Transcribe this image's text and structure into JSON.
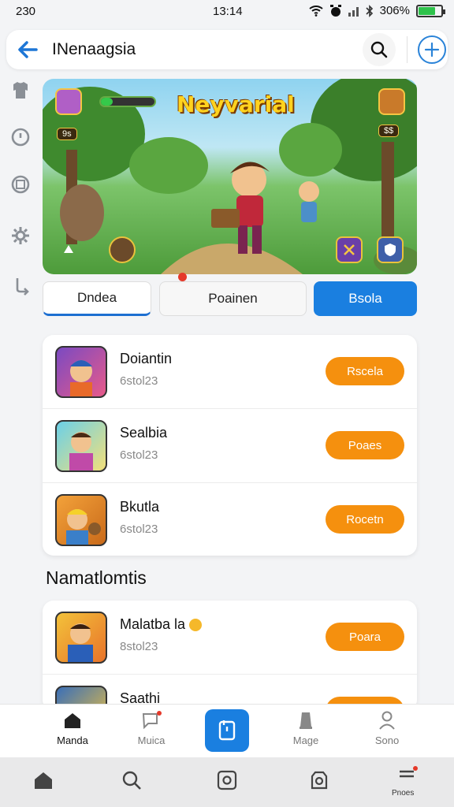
{
  "status_bar": {
    "left": "230",
    "time": "13:14",
    "battery": "306%"
  },
  "header": {
    "title": "INenaagsia"
  },
  "banner": {
    "title": "Neyvarial",
    "hud_chip_left": "9s",
    "hud_chip_right": "$$"
  },
  "tabs": [
    {
      "label": "Dndea"
    },
    {
      "label": "Poainen"
    },
    {
      "label": "Bsola"
    }
  ],
  "list1": [
    {
      "title": "Doiantin",
      "sub": "6stol23",
      "action": "Rscela"
    },
    {
      "title": "Sealbia",
      "sub": "6stol23",
      "action": "Poaes"
    },
    {
      "title": "Bkutla",
      "sub": "6stol23",
      "action": "Rocetn"
    }
  ],
  "section_title": "Namatlomtis",
  "list2": [
    {
      "title": "Malatba la",
      "sub": "8stol23",
      "action": "Poara"
    },
    {
      "title": "Saathi",
      "sub": "",
      "action": ""
    }
  ],
  "bottom_nav": [
    {
      "label": "Manda"
    },
    {
      "label": "Muica"
    },
    {
      "label": "Mage"
    },
    {
      "label": "Sono"
    }
  ],
  "system_nav": {
    "label": "Pnoes"
  },
  "colors": {
    "accent": "#1a7fe0",
    "action": "#f5900e",
    "badge": "#e5392a"
  }
}
